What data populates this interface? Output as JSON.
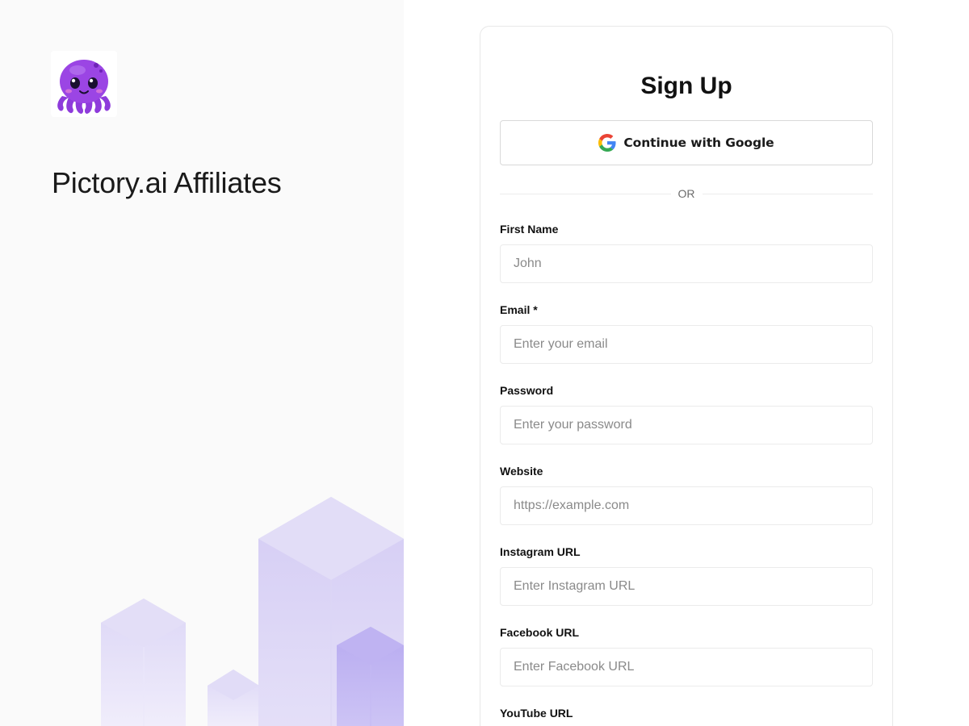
{
  "brand": {
    "logo_icon": "octopus-mascot-icon",
    "title": "Pictory.ai Affiliates"
  },
  "signup": {
    "title": "Sign Up",
    "google_label": "Continue with Google",
    "google_icon": "google-g-icon",
    "divider": "OR",
    "fields": [
      {
        "label": "First Name",
        "placeholder": "John",
        "value": ""
      },
      {
        "label": "Email *",
        "placeholder": "Enter your email",
        "value": ""
      },
      {
        "label": "Password",
        "placeholder": "Enter your password",
        "value": ""
      },
      {
        "label": "Website",
        "placeholder": "https://example.com",
        "value": ""
      },
      {
        "label": "Instagram URL",
        "placeholder": "Enter Instagram URL",
        "value": ""
      },
      {
        "label": "Facebook URL",
        "placeholder": "Enter Facebook URL",
        "value": ""
      },
      {
        "label": "YouTube URL",
        "placeholder": "",
        "value": ""
      }
    ]
  },
  "colors": {
    "accent_purple": "#9b45e4",
    "decoration_lavender": "#c7bdf5",
    "left_panel_bg": "#fafafa"
  }
}
